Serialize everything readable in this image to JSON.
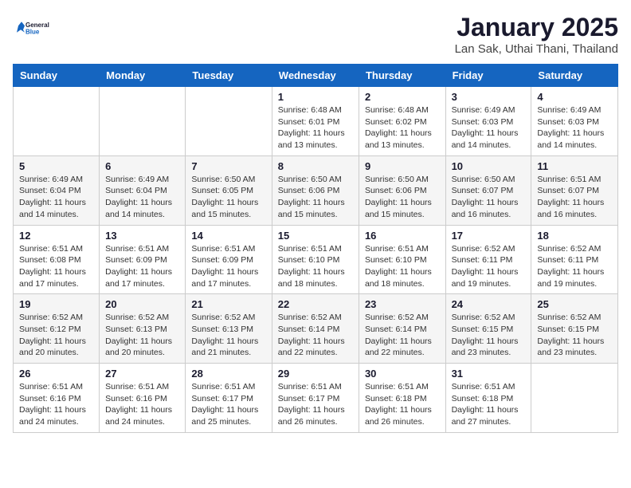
{
  "header": {
    "logo_general": "General",
    "logo_blue": "Blue",
    "main_title": "January 2025",
    "sub_title": "Lan Sak, Uthai Thani, Thailand"
  },
  "weekdays": [
    "Sunday",
    "Monday",
    "Tuesday",
    "Wednesday",
    "Thursday",
    "Friday",
    "Saturday"
  ],
  "weeks": [
    [
      {
        "day": "",
        "info": ""
      },
      {
        "day": "",
        "info": ""
      },
      {
        "day": "",
        "info": ""
      },
      {
        "day": "1",
        "info": "Sunrise: 6:48 AM\nSunset: 6:01 PM\nDaylight: 11 hours and 13 minutes."
      },
      {
        "day": "2",
        "info": "Sunrise: 6:48 AM\nSunset: 6:02 PM\nDaylight: 11 hours and 13 minutes."
      },
      {
        "day": "3",
        "info": "Sunrise: 6:49 AM\nSunset: 6:03 PM\nDaylight: 11 hours and 14 minutes."
      },
      {
        "day": "4",
        "info": "Sunrise: 6:49 AM\nSunset: 6:03 PM\nDaylight: 11 hours and 14 minutes."
      }
    ],
    [
      {
        "day": "5",
        "info": "Sunrise: 6:49 AM\nSunset: 6:04 PM\nDaylight: 11 hours and 14 minutes."
      },
      {
        "day": "6",
        "info": "Sunrise: 6:49 AM\nSunset: 6:04 PM\nDaylight: 11 hours and 14 minutes."
      },
      {
        "day": "7",
        "info": "Sunrise: 6:50 AM\nSunset: 6:05 PM\nDaylight: 11 hours and 15 minutes."
      },
      {
        "day": "8",
        "info": "Sunrise: 6:50 AM\nSunset: 6:06 PM\nDaylight: 11 hours and 15 minutes."
      },
      {
        "day": "9",
        "info": "Sunrise: 6:50 AM\nSunset: 6:06 PM\nDaylight: 11 hours and 15 minutes."
      },
      {
        "day": "10",
        "info": "Sunrise: 6:50 AM\nSunset: 6:07 PM\nDaylight: 11 hours and 16 minutes."
      },
      {
        "day": "11",
        "info": "Sunrise: 6:51 AM\nSunset: 6:07 PM\nDaylight: 11 hours and 16 minutes."
      }
    ],
    [
      {
        "day": "12",
        "info": "Sunrise: 6:51 AM\nSunset: 6:08 PM\nDaylight: 11 hours and 17 minutes."
      },
      {
        "day": "13",
        "info": "Sunrise: 6:51 AM\nSunset: 6:09 PM\nDaylight: 11 hours and 17 minutes."
      },
      {
        "day": "14",
        "info": "Sunrise: 6:51 AM\nSunset: 6:09 PM\nDaylight: 11 hours and 17 minutes."
      },
      {
        "day": "15",
        "info": "Sunrise: 6:51 AM\nSunset: 6:10 PM\nDaylight: 11 hours and 18 minutes."
      },
      {
        "day": "16",
        "info": "Sunrise: 6:51 AM\nSunset: 6:10 PM\nDaylight: 11 hours and 18 minutes."
      },
      {
        "day": "17",
        "info": "Sunrise: 6:52 AM\nSunset: 6:11 PM\nDaylight: 11 hours and 19 minutes."
      },
      {
        "day": "18",
        "info": "Sunrise: 6:52 AM\nSunset: 6:11 PM\nDaylight: 11 hours and 19 minutes."
      }
    ],
    [
      {
        "day": "19",
        "info": "Sunrise: 6:52 AM\nSunset: 6:12 PM\nDaylight: 11 hours and 20 minutes."
      },
      {
        "day": "20",
        "info": "Sunrise: 6:52 AM\nSunset: 6:13 PM\nDaylight: 11 hours and 20 minutes."
      },
      {
        "day": "21",
        "info": "Sunrise: 6:52 AM\nSunset: 6:13 PM\nDaylight: 11 hours and 21 minutes."
      },
      {
        "day": "22",
        "info": "Sunrise: 6:52 AM\nSunset: 6:14 PM\nDaylight: 11 hours and 22 minutes."
      },
      {
        "day": "23",
        "info": "Sunrise: 6:52 AM\nSunset: 6:14 PM\nDaylight: 11 hours and 22 minutes."
      },
      {
        "day": "24",
        "info": "Sunrise: 6:52 AM\nSunset: 6:15 PM\nDaylight: 11 hours and 23 minutes."
      },
      {
        "day": "25",
        "info": "Sunrise: 6:52 AM\nSunset: 6:15 PM\nDaylight: 11 hours and 23 minutes."
      }
    ],
    [
      {
        "day": "26",
        "info": "Sunrise: 6:51 AM\nSunset: 6:16 PM\nDaylight: 11 hours and 24 minutes."
      },
      {
        "day": "27",
        "info": "Sunrise: 6:51 AM\nSunset: 6:16 PM\nDaylight: 11 hours and 24 minutes."
      },
      {
        "day": "28",
        "info": "Sunrise: 6:51 AM\nSunset: 6:17 PM\nDaylight: 11 hours and 25 minutes."
      },
      {
        "day": "29",
        "info": "Sunrise: 6:51 AM\nSunset: 6:17 PM\nDaylight: 11 hours and 26 minutes."
      },
      {
        "day": "30",
        "info": "Sunrise: 6:51 AM\nSunset: 6:18 PM\nDaylight: 11 hours and 26 minutes."
      },
      {
        "day": "31",
        "info": "Sunrise: 6:51 AM\nSunset: 6:18 PM\nDaylight: 11 hours and 27 minutes."
      },
      {
        "day": "",
        "info": ""
      }
    ]
  ]
}
